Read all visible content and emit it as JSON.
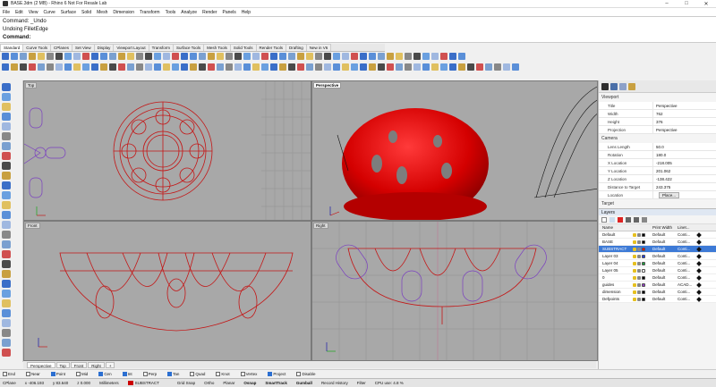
{
  "window": {
    "title": "BASE.3dm (2 MB) - Rhino 6 Not For Resale Lab",
    "minimize": "–",
    "maximize": "□",
    "close": "✕"
  },
  "menu": [
    "File",
    "Edit",
    "View",
    "Curve",
    "Surface",
    "Solid",
    "Mesh",
    "Dimension",
    "Transform",
    "Tools",
    "Analyze",
    "Render",
    "Panels",
    "Help"
  ],
  "command": {
    "line1": "Command: _Undo",
    "line2": "Undoing FilletEdge",
    "prompt": "Command:"
  },
  "toolbar_tabs": [
    "Standard",
    "Curve Tools",
    "CPlanes",
    "Set View",
    "Display",
    "Viewport Layout",
    "Transform",
    "Surface Tools",
    "Mesh Tools",
    "Solid Tools",
    "Render Tools",
    "Drafting",
    "New in V6"
  ],
  "viewports": {
    "top": {
      "label": "Top"
    },
    "perspective": {
      "label": "Perspective"
    },
    "front": {
      "label": "Front"
    },
    "right": {
      "label": "Right"
    }
  },
  "viewport_tabs": [
    "Perspective",
    "Top",
    "Front",
    "Right"
  ],
  "viewport_tab_add": "+",
  "osnap": [
    {
      "label": "End",
      "on": false
    },
    {
      "label": "Near",
      "on": false
    },
    {
      "label": "Point",
      "on": true
    },
    {
      "label": "Mid",
      "on": false
    },
    {
      "label": "Cen",
      "on": true
    },
    {
      "label": "Int",
      "on": true
    },
    {
      "label": "Perp",
      "on": false
    },
    {
      "label": "Tan",
      "on": true
    },
    {
      "label": "Quad",
      "on": false
    },
    {
      "label": "Knot",
      "on": false
    },
    {
      "label": "Vertex",
      "on": false
    },
    {
      "label": "Project",
      "on": true
    },
    {
      "label": "Disable",
      "on": false
    }
  ],
  "status": {
    "cplane": "CPlane",
    "x": "x -406.193",
    "y": "y 83.640",
    "z": "z 0.000",
    "units": "Millimeters",
    "layer": "SUBSTRACT",
    "grid_snap": "Grid Snap",
    "ortho": "Ortho",
    "planar": "Planar",
    "osnap": "Osnap",
    "smarttrack": "SmartTrack",
    "gumball": "Gumball",
    "record_history": "Record History",
    "filter": "Filter",
    "cpu": "CPU use: 4.8 %"
  },
  "properties": {
    "viewport_section": "Viewport",
    "rows": [
      {
        "k": "Title",
        "v": "Perspective"
      },
      {
        "k": "Width",
        "v": "762"
      },
      {
        "k": "Height",
        "v": "376"
      },
      {
        "k": "Projection",
        "v": "Perspective"
      }
    ],
    "camera_section": "Camera",
    "camera_rows": [
      {
        "k": "Lens Length",
        "v": "50.0"
      },
      {
        "k": "Rotation",
        "v": "180.0"
      },
      {
        "k": "X Location",
        "v": "-218.005"
      },
      {
        "k": "Y Location",
        "v": "201.062"
      },
      {
        "k": "Z Location",
        "v": "-138.422"
      },
      {
        "k": "Distance to Target",
        "v": "243.375"
      }
    ],
    "location_label": "Location",
    "place_btn": "Place...",
    "target_section": "Target"
  },
  "layers": {
    "title": "Layers",
    "headers": {
      "name": "Name",
      "print_width": "Print Width",
      "linetype": "Linet..."
    },
    "rows": [
      {
        "name": "Default",
        "color": "#000000",
        "pw": "Default",
        "lt": "Conti...",
        "sel": false
      },
      {
        "name": "BASE",
        "color": "#000000",
        "pw": "Default",
        "lt": "Conti...",
        "sel": false
      },
      {
        "name": "SUBSTRACT",
        "color": "#ff0000",
        "pw": "Default",
        "lt": "Conti...",
        "sel": true
      },
      {
        "name": "Layer 03",
        "color": "#2040ff",
        "pw": "Default",
        "lt": "Conti...",
        "sel": false
      },
      {
        "name": "Layer 04",
        "color": "#20a040",
        "pw": "Default",
        "lt": "Conti...",
        "sel": false
      },
      {
        "name": "Layer 05",
        "color": "#ffffff",
        "pw": "Default",
        "lt": "Conti...",
        "sel": false
      },
      {
        "name": "0",
        "color": "#000000",
        "pw": "Default",
        "lt": "Conti...",
        "sel": false
      },
      {
        "name": "guides",
        "color": "#9040c0",
        "pw": "Default",
        "lt": "ACAD...",
        "sel": false
      },
      {
        "name": "dimension",
        "color": "#000000",
        "pw": "Default",
        "lt": "Conti...",
        "sel": false
      },
      {
        "name": "Defpoints",
        "color": "#000000",
        "pw": "Default",
        "lt": "Conti...",
        "sel": false
      }
    ]
  }
}
